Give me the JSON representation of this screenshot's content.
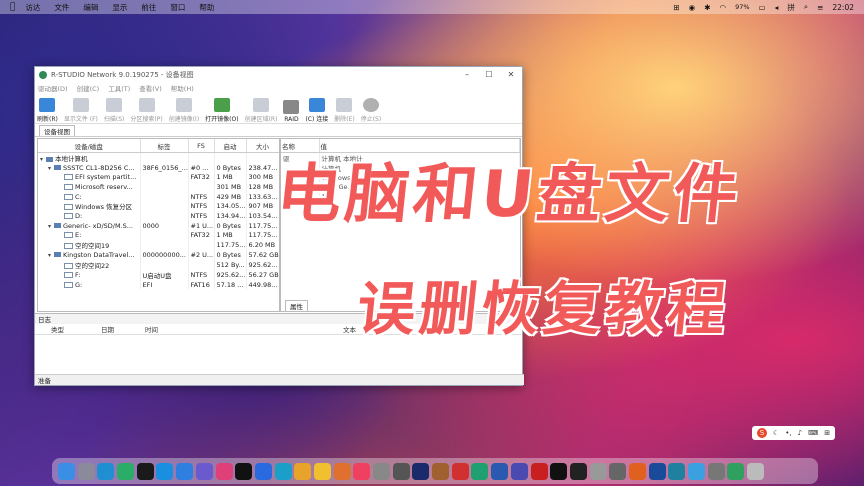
{
  "menubar": {
    "items": [
      "访达",
      "文件",
      "编辑",
      "显示",
      "前往",
      "窗口",
      "帮助"
    ],
    "battery": "97%",
    "time": "22:02"
  },
  "window": {
    "title": "R-STUDIO Network 9.0.190275 - 设备视图",
    "menus": [
      "驱动器(D)",
      "创建(C)",
      "工具(T)",
      "查看(V)",
      "帮助(H)"
    ],
    "toolbar": [
      {
        "label": "刷新(R)",
        "enabled": true
      },
      {
        "label": "显示文件 (F)",
        "enabled": false
      },
      {
        "label": "扫描(S)",
        "enabled": false
      },
      {
        "label": "分区搜索(P)",
        "enabled": false
      },
      {
        "label": "创建镜像(I)",
        "enabled": false
      },
      {
        "label": "打开镜像(O)",
        "enabled": true
      },
      {
        "label": "创建区域(R)",
        "enabled": false
      },
      {
        "label": "RAID",
        "enabled": true
      },
      {
        "label": "(C) 连接",
        "enabled": true
      },
      {
        "label": "删除(E)",
        "enabled": false
      },
      {
        "label": "停止(S)",
        "enabled": false
      }
    ],
    "tab": "设备视图",
    "device_table": {
      "headers": [
        "设备/磁盘",
        "标签",
        "FS",
        "启动",
        "大小"
      ],
      "rows": [
        {
          "level": 0,
          "name": "本地计算机",
          "label": "",
          "fs": "",
          "start": "",
          "size": ""
        },
        {
          "level": 1,
          "name": "SSSTC CL1-8D256 C...",
          "label": "38F6_0156_...",
          "fs": "#0 ...",
          "start": "0 Bytes",
          "size": "238.47..."
        },
        {
          "level": 2,
          "name": "EFI system partit...",
          "label": "",
          "fs": "FAT32",
          "start": "1 MB",
          "size": "300 MB"
        },
        {
          "level": 2,
          "name": "Microsoft reserv...",
          "label": "",
          "fs": "",
          "start": "301 MB",
          "size": "128 MB"
        },
        {
          "level": 2,
          "name": "C:",
          "label": "",
          "fs": "NTFS",
          "start": "429 MB",
          "size": "133.63..."
        },
        {
          "level": 2,
          "name": "Windows 恢复分区",
          "label": "",
          "fs": "NTFS",
          "start": "134.05...",
          "size": "907 MB"
        },
        {
          "level": 2,
          "name": "D:",
          "label": "",
          "fs": "NTFS",
          "start": "134.94...",
          "size": "103.54..."
        },
        {
          "level": 1,
          "name": "Generic- xD/SD/M.S...",
          "label": "0000",
          "fs": "#1 U...",
          "start": "0 Bytes",
          "size": "117.75..."
        },
        {
          "level": 2,
          "name": "E:",
          "label": "",
          "fs": "FAT32",
          "start": "1 MB",
          "size": "117.75..."
        },
        {
          "level": 2,
          "name": "空的空间19",
          "label": "",
          "fs": "",
          "start": "117.75...",
          "size": "6.20 MB"
        },
        {
          "level": 1,
          "name": "Kingston DataTravel...",
          "label": "000000000...",
          "fs": "#2 U...",
          "start": "0 Bytes",
          "size": "57.62 GB"
        },
        {
          "level": 2,
          "name": "空的空间22",
          "label": "",
          "fs": "",
          "start": "512 By...",
          "size": "925.62..."
        },
        {
          "level": 2,
          "name": "F:",
          "label": "U启动U盘",
          "fs": "NTFS",
          "start": "925.62...",
          "size": "56.27 GB"
        },
        {
          "level": 2,
          "name": "G:",
          "label": "EFI",
          "fs": "FAT16",
          "start": "57.18 ...",
          "size": "449.98..."
        }
      ]
    },
    "props_table": {
      "headers": [
        "名称",
        "值"
      ],
      "rows": [
        {
          "name": "驱",
          "value": "计算机 本地计"
        },
        {
          "name": "",
          "value": "计算机"
        },
        {
          "name": "",
          "value": "Windows 10"
        },
        {
          "name": "",
          "value": "11th Ge... 115"
        },
        {
          "name": "",
          "value": "16..."
        }
      ],
      "tab": "属性"
    },
    "log": {
      "title": "日志",
      "columns": [
        "类型",
        "日期",
        "时间",
        "文本"
      ]
    },
    "status": "准备"
  },
  "overlay": {
    "line1": "电脑和U盘文件",
    "line2": "误删恢复教程"
  },
  "ime": {
    "label": "S"
  },
  "dock": {
    "apps": [
      {
        "name": "finder",
        "color": "#3a8ee6"
      },
      {
        "name": "launchpad",
        "color": "#8a8a9a"
      },
      {
        "name": "edge",
        "color": "#1f8fd1"
      },
      {
        "name": "wechat",
        "color": "#2aae67"
      },
      {
        "name": "qq",
        "color": "#1a1a1a"
      },
      {
        "name": "skype",
        "color": "#1a8fe0"
      },
      {
        "name": "safari",
        "color": "#2f7fe0"
      },
      {
        "name": "music-app",
        "color": "#6a5acd"
      },
      {
        "name": "app-pink",
        "color": "#e0407a"
      },
      {
        "name": "iqiyi",
        "color": "#111"
      },
      {
        "name": "app-blue",
        "color": "#2a6ae0"
      },
      {
        "name": "app-cyan",
        "color": "#1aa0c8"
      },
      {
        "name": "chrome",
        "color": "#e8a32a"
      },
      {
        "name": "app-yellow",
        "color": "#f0c030"
      },
      {
        "name": "app-orange",
        "color": "#e07030"
      },
      {
        "name": "itunes",
        "color": "#f04060"
      },
      {
        "name": "app-grey",
        "color": "#888"
      },
      {
        "name": "camera",
        "color": "#555"
      },
      {
        "name": "photoshop",
        "color": "#1a2a6a"
      },
      {
        "name": "app-brown",
        "color": "#a06030"
      },
      {
        "name": "app-red",
        "color": "#d03030"
      },
      {
        "name": "app-green",
        "color": "#20a070"
      },
      {
        "name": "word",
        "color": "#2a5ab0"
      },
      {
        "name": "app-indigo",
        "color": "#4a4ab0"
      },
      {
        "name": "record",
        "color": "#c82020"
      },
      {
        "name": "tiktok",
        "color": "#111"
      },
      {
        "name": "capcut",
        "color": "#222"
      },
      {
        "name": "app-silver",
        "color": "#999"
      },
      {
        "name": "calculator",
        "color": "#666"
      },
      {
        "name": "app-orange2",
        "color": "#e06020"
      },
      {
        "name": "app-navy",
        "color": "#1a4a9a"
      },
      {
        "name": "app-teal",
        "color": "#2080a0"
      },
      {
        "name": "app-sky",
        "color": "#3aa0e0"
      },
      {
        "name": "settings",
        "color": "#777"
      },
      {
        "name": "app-green2",
        "color": "#30a060"
      },
      {
        "name": "trash",
        "color": "#bbb"
      }
    ]
  }
}
